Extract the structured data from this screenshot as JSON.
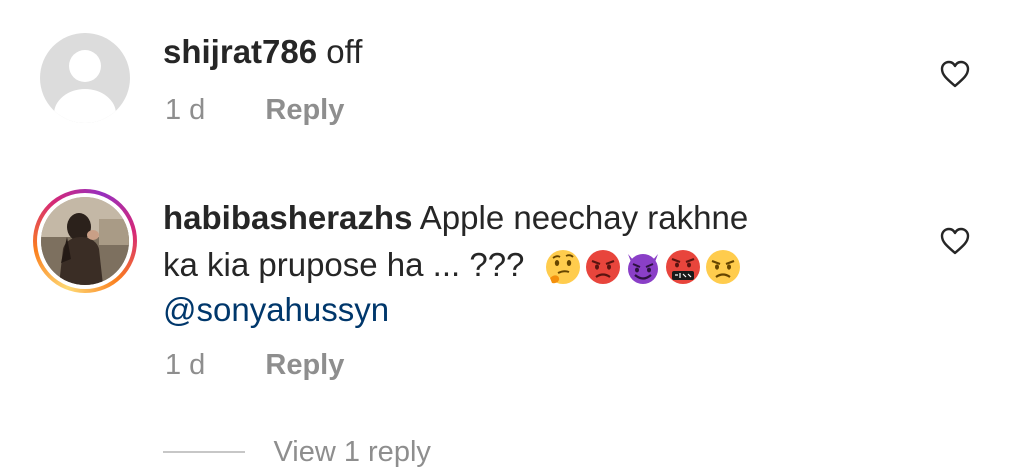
{
  "comments": [
    {
      "username": "shijrat786",
      "text": "off",
      "time": "1 d",
      "reply_label": "Reply",
      "avatar": "default-avatar"
    },
    {
      "username": "habibasherazhs",
      "text_line1": "Apple neechay rakhne",
      "text_line2": "ka kia prupose ha ... ???",
      "mention": "@sonyahussyn",
      "time": "1 d",
      "reply_label": "Reply",
      "avatar": "story-ring-avatar",
      "emojis": [
        "thinking-face",
        "angry-face",
        "smiling-devil",
        "cursing-face",
        "angry-face"
      ]
    }
  ],
  "view_replies_label": "View 1 reply",
  "colors": {
    "text": "#262626",
    "secondary": "#8e8e8e",
    "mention": "#00376b",
    "divider": "#c7c7c7"
  }
}
